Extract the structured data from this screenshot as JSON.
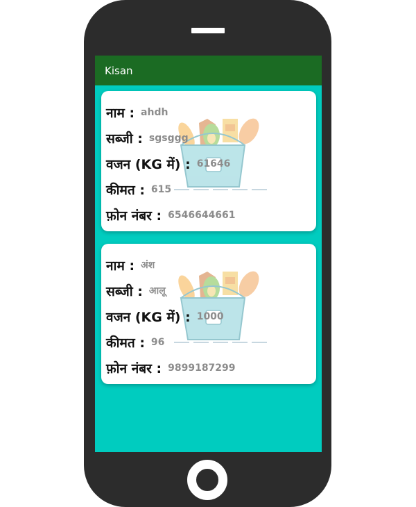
{
  "app": {
    "title": "Kisan"
  },
  "labels": {
    "name": "नाम :",
    "vegetable": "सब्जी :",
    "weight": "वजन (KG में) :",
    "price": "कीमत :",
    "phone": "फ़ोन नंबर :"
  },
  "cards": [
    {
      "name": "ahdh",
      "vegetable": "sgsggg",
      "weight": "61646",
      "price": "615",
      "phone": "6546644661"
    },
    {
      "name": "अंश",
      "vegetable": "आलू",
      "weight": "1000",
      "price": "96",
      "phone": "9899187299"
    }
  ],
  "icons": {
    "card_background": "vegetable-basket-icon",
    "home": "home-button-icon"
  },
  "colors": {
    "app_bar": "#1b6b23",
    "screen_bg": "#00ccbf",
    "card_bg": "#ffffff",
    "phone_body": "#2c2c2c"
  }
}
